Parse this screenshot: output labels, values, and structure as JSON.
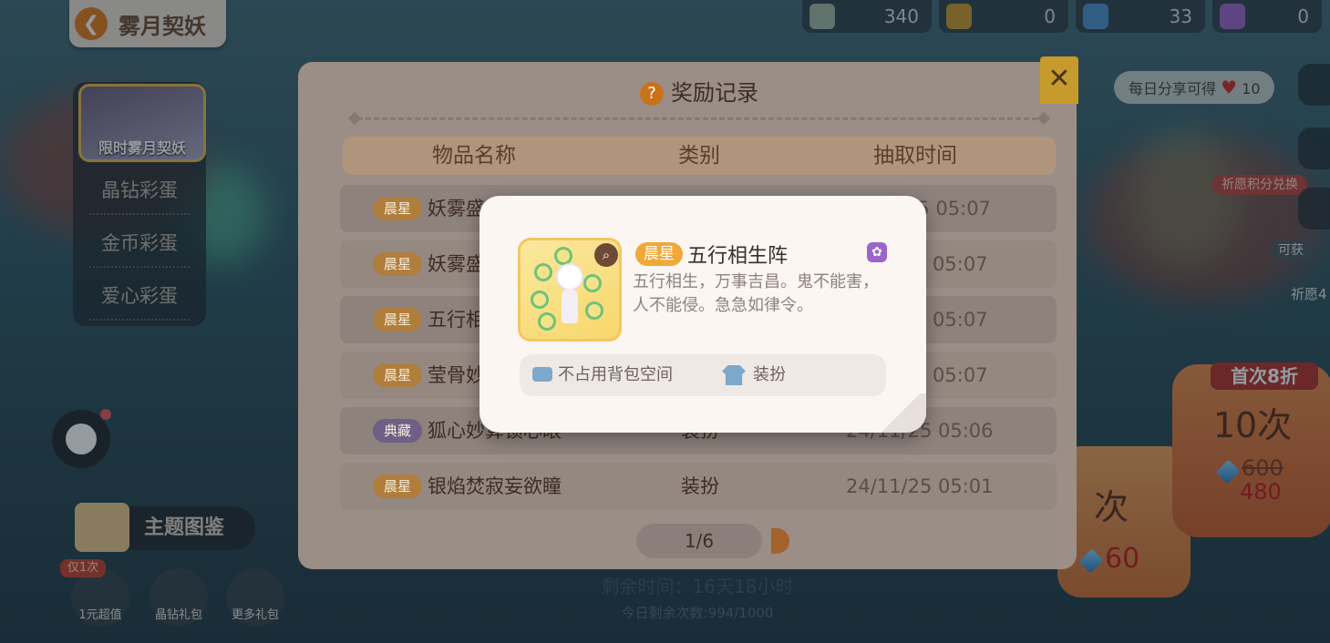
{
  "topbar": {
    "currencies": [
      {
        "icon": "ticket-icon",
        "value": "340"
      },
      {
        "icon": "key-icon",
        "value": "0"
      },
      {
        "icon": "gem-plus-icon",
        "value": "33"
      },
      {
        "icon": "wand-icon",
        "value": "0"
      }
    ]
  },
  "header": {
    "title": "雾月契妖",
    "back_glyph": "❮"
  },
  "sidebar": {
    "limited_label": "限时雾月契妖",
    "items": [
      {
        "label": "晶钻彩蛋"
      },
      {
        "label": "金币彩蛋"
      },
      {
        "label": "爱心彩蛋"
      }
    ]
  },
  "record": {
    "title": "奖励记录",
    "help_glyph": "?",
    "close_glyph": "✕",
    "columns": [
      "物品名称",
      "类别",
      "抽取时间"
    ],
    "rows": [
      {
        "tag": "晨星",
        "tag_type": "cx",
        "name": "妖雾盛",
        "type": "",
        "time": "25 05:07"
      },
      {
        "tag": "晨星",
        "tag_type": "cx",
        "name": "妖雾盛",
        "type": "",
        "time": "5 05:07"
      },
      {
        "tag": "晨星",
        "tag_type": "cx",
        "name": "五行相",
        "type": "",
        "time": "5 05:07"
      },
      {
        "tag": "晨星",
        "tag_type": "cx",
        "name": "莹骨妙",
        "type": "",
        "time": "5 05:07"
      },
      {
        "tag": "典藏",
        "tag_type": "dc",
        "name": "狐心妙算锁心眼",
        "type": "装扮",
        "time": "24/11/25 05:06"
      },
      {
        "tag": "晨星",
        "tag_type": "cx",
        "name": "银焰焚寂妄欲瞳",
        "type": "装扮",
        "time": "24/11/25 05:01"
      }
    ],
    "page": "1/6"
  },
  "footer": {
    "remaining_time": "剩余时间：16天18小时",
    "today_remaining": "今日剩余次数:994/1000"
  },
  "right": {
    "share_text": "每日分享可得",
    "share_count": "10",
    "wish_exchange": "祈愿积分兑换",
    "can_get": "可获",
    "wish_count": "祈愿4",
    "ten_draw": {
      "discount": "首次8折",
      "label": "10次",
      "old_price": "600",
      "new_price": "480"
    },
    "one_draw": {
      "label": "次",
      "price": "60"
    }
  },
  "bottom_left": {
    "theme_label": "主题图鉴",
    "only_once": "仅1次",
    "gifts": [
      {
        "label": "1元超值",
        "icon": "gift-box-icon"
      },
      {
        "label": "晶钻礼包",
        "icon": "check-icon"
      },
      {
        "label": "更多礼包",
        "icon": "present-icon"
      }
    ]
  },
  "popup": {
    "tag": "晨星",
    "name": "五行相生阵",
    "description": "五行相生，万事吉昌。鬼不能害，人不能侵。急急如律令。",
    "info1": "不占用背包空间",
    "info2": "装扮"
  },
  "colors": {
    "accent": "#f0a938",
    "tag_cx": "#b07e3c",
    "tag_dc": "#6d5f85",
    "price_red": "#c01a1a"
  }
}
